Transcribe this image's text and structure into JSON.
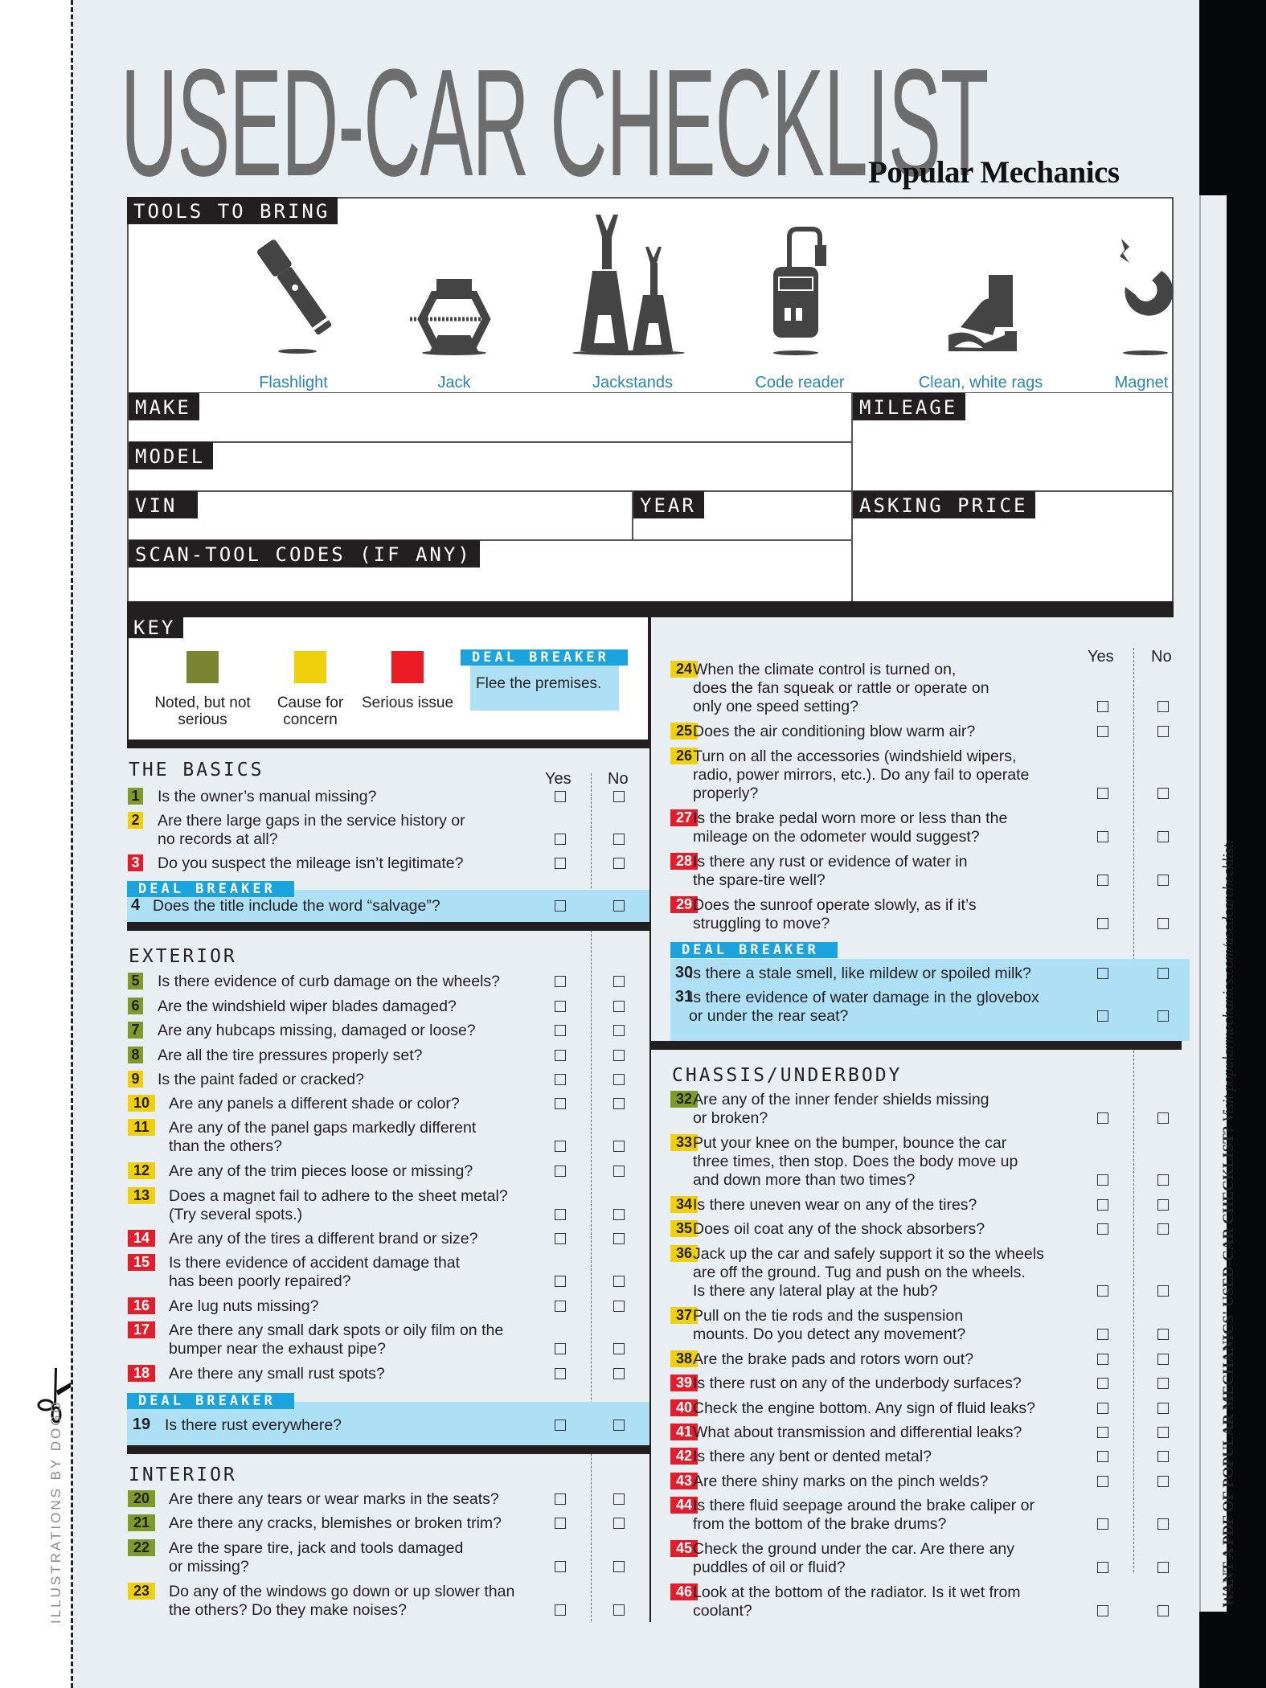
{
  "title": "USED-CAR CHECKLIST",
  "brand": "Popular Mechanics",
  "side_note": {
    "bold": "WANT A PDF OF POPULAR MECHANICS' USED-CAR CHECKLIST?",
    "italic": " Visit popularmechanics.com/usedcarchecklist."
  },
  "credit": "ILLUSTRATIONS BY DOGO",
  "tools": {
    "header": "TOOLS TO BRING",
    "items": [
      {
        "label": "Flashlight",
        "icon": "flashlight-icon"
      },
      {
        "label": "Jack",
        "icon": "jack-icon"
      },
      {
        "label": "Jackstands",
        "icon": "jackstands-icon"
      },
      {
        "label": "Code reader",
        "icon": "code-reader-icon"
      },
      {
        "label": "Clean, white rags",
        "icon": "rags-icon"
      },
      {
        "label": "Magnet",
        "icon": "magnet-icon"
      }
    ]
  },
  "form": {
    "make": "MAKE",
    "model": "MODEL",
    "vin": "VIN",
    "year": "YEAR",
    "scan": "SCAN-TOOL CODES (IF ANY)",
    "mileage": "MILEAGE",
    "price": "ASKING PRICE"
  },
  "key": {
    "header": "KEY",
    "items": [
      {
        "color": "#7a8431",
        "label": "Noted, but\nnot serious"
      },
      {
        "color": "#f0cf0d",
        "label": "Cause for\nconcern"
      },
      {
        "color": "#e31e2c",
        "label": "Serious\nissue"
      }
    ],
    "deal_breaker_tab": "DEAL BREAKER",
    "deal_breaker_text": "Flee the premises."
  },
  "columns": {
    "yes": "Yes",
    "no": "No"
  },
  "deal_breaker_label": "DEAL BREAKER",
  "sections": {
    "basics": {
      "title": "THE BASICS",
      "items": [
        {
          "n": "1",
          "sev": "green",
          "text": "Is the owner’s manual missing?"
        },
        {
          "n": "2",
          "sev": "yellow",
          "text": "Are there large gaps in the service history or\nno records at all?"
        },
        {
          "n": "3",
          "sev": "red",
          "text": "Do you suspect the mileage isn’t legitimate?"
        },
        {
          "n": "4",
          "sev": "dealbreaker",
          "text": "Does the title include the word “salvage”?"
        }
      ]
    },
    "exterior": {
      "title": "EXTERIOR",
      "items": [
        {
          "n": "5",
          "sev": "green",
          "text": "Is there evidence of curb damage on the wheels?"
        },
        {
          "n": "6",
          "sev": "green",
          "text": "Are the windshield wiper blades damaged?"
        },
        {
          "n": "7",
          "sev": "green",
          "text": "Are any hubcaps missing, damaged or loose?"
        },
        {
          "n": "8",
          "sev": "green",
          "text": "Are all the tire pressures properly set?"
        },
        {
          "n": "9",
          "sev": "yellow",
          "text": "Is the paint faded or cracked?"
        },
        {
          "n": "10",
          "sev": "yellow",
          "text": "Are any panels a different shade or color?"
        },
        {
          "n": "11",
          "sev": "yellow",
          "text": "Are any of the panel gaps markedly different\nthan the others?"
        },
        {
          "n": "12",
          "sev": "yellow",
          "text": "Are any of the trim pieces loose or missing?"
        },
        {
          "n": "13",
          "sev": "yellow",
          "text": "Does a magnet fail to adhere to the sheet metal?\n(Try several spots.)"
        },
        {
          "n": "14",
          "sev": "red",
          "text": "Are any of the tires a different brand or size?"
        },
        {
          "n": "15",
          "sev": "red",
          "text": "Is there evidence of accident damage that\nhas been poorly repaired?"
        },
        {
          "n": "16",
          "sev": "red",
          "text": "Are lug nuts missing?"
        },
        {
          "n": "17",
          "sev": "red",
          "text": "Are there any small dark spots or oily film on the\nbumper near the exhaust pipe?"
        },
        {
          "n": "18",
          "sev": "red",
          "text": "Are there any small rust spots?"
        },
        {
          "n": "19",
          "sev": "dealbreaker",
          "text": "Is there rust everywhere?"
        }
      ]
    },
    "interior": {
      "title": "INTERIOR",
      "items": [
        {
          "n": "20",
          "sev": "green",
          "text": "Are there any tears or wear marks in the seats?"
        },
        {
          "n": "21",
          "sev": "green",
          "text": "Are there any cracks, blemishes or broken trim?"
        },
        {
          "n": "22",
          "sev": "green",
          "text": "Are the spare tire, jack and tools damaged\nor missing?"
        },
        {
          "n": "23",
          "sev": "yellow",
          "text": "Do any of the windows go down or up slower than\nthe others? Do they make noises?"
        },
        {
          "n": "24",
          "sev": "yellow",
          "text": "When the climate control is turned on,\ndoes the fan squeak or rattle or operate on\nonly one speed setting?"
        },
        {
          "n": "25",
          "sev": "yellow",
          "text": "Does the air conditioning blow warm air?"
        },
        {
          "n": "26",
          "sev": "yellow",
          "text": "Turn on all the accessories (windshield wipers,\nradio, power mirrors, etc.). Do any fail to operate\nproperly?"
        },
        {
          "n": "27",
          "sev": "red",
          "text": "Is the brake pedal worn more or less than the\nmileage on the odometer would suggest?"
        },
        {
          "n": "28",
          "sev": "red",
          "text": "Is there any rust or evidence of water in\nthe spare-tire well?"
        },
        {
          "n": "29",
          "sev": "red",
          "text": "Does the sunroof operate slowly, as if it’s\nstruggling to move?"
        },
        {
          "n": "30",
          "sev": "dealbreaker",
          "text": "Is there a stale smell, like mildew or spoiled milk?"
        },
        {
          "n": "31",
          "sev": "dealbreaker",
          "text": "Is there evidence of water damage in the glovebox\nor under the rear seat?"
        }
      ]
    },
    "chassis": {
      "title": "CHASSIS/UNDERBODY",
      "items": [
        {
          "n": "32",
          "sev": "green",
          "text": "Are any of the inner fender shields missing\nor broken?"
        },
        {
          "n": "33",
          "sev": "yellow",
          "text": "Put your knee on the bumper, bounce the car\nthree times, then stop. Does the body move up\nand down more than two times?"
        },
        {
          "n": "34",
          "sev": "yellow",
          "text": "Is there uneven wear on any of the tires?"
        },
        {
          "n": "35",
          "sev": "yellow",
          "text": "Does oil coat any of the shock absorbers?"
        },
        {
          "n": "36",
          "sev": "yellow",
          "text": "Jack up the car and safely support it so the wheels\nare off the ground. Tug and push on the wheels.\nIs there any lateral play at the hub?"
        },
        {
          "n": "37",
          "sev": "yellow",
          "text": "Pull on the tie rods and the suspension\nmounts. Do you detect any movement?"
        },
        {
          "n": "38",
          "sev": "yellow",
          "text": "Are the brake pads and rotors worn out?"
        },
        {
          "n": "39",
          "sev": "red",
          "text": "Is there rust on any of the underbody surfaces?"
        },
        {
          "n": "40",
          "sev": "red",
          "text": "Check the engine bottom. Any sign of fluid leaks?"
        },
        {
          "n": "41",
          "sev": "red",
          "text": "What about transmission and differential leaks?"
        },
        {
          "n": "42",
          "sev": "red",
          "text": "Is there any bent or dented metal?"
        },
        {
          "n": "43",
          "sev": "red",
          "text": "Are there shiny marks on the pinch welds?"
        },
        {
          "n": "44",
          "sev": "red",
          "text": "Is there fluid seepage around the brake caliper or\nfrom the bottom of the brake drums?"
        },
        {
          "n": "45",
          "sev": "red",
          "text": "Check the ground under the car. Are there any\npuddles of oil or fluid?"
        },
        {
          "n": "46",
          "sev": "red",
          "text": "Look at the bottom of the radiator. Is it wet from\ncoolant?"
        }
      ]
    }
  }
}
